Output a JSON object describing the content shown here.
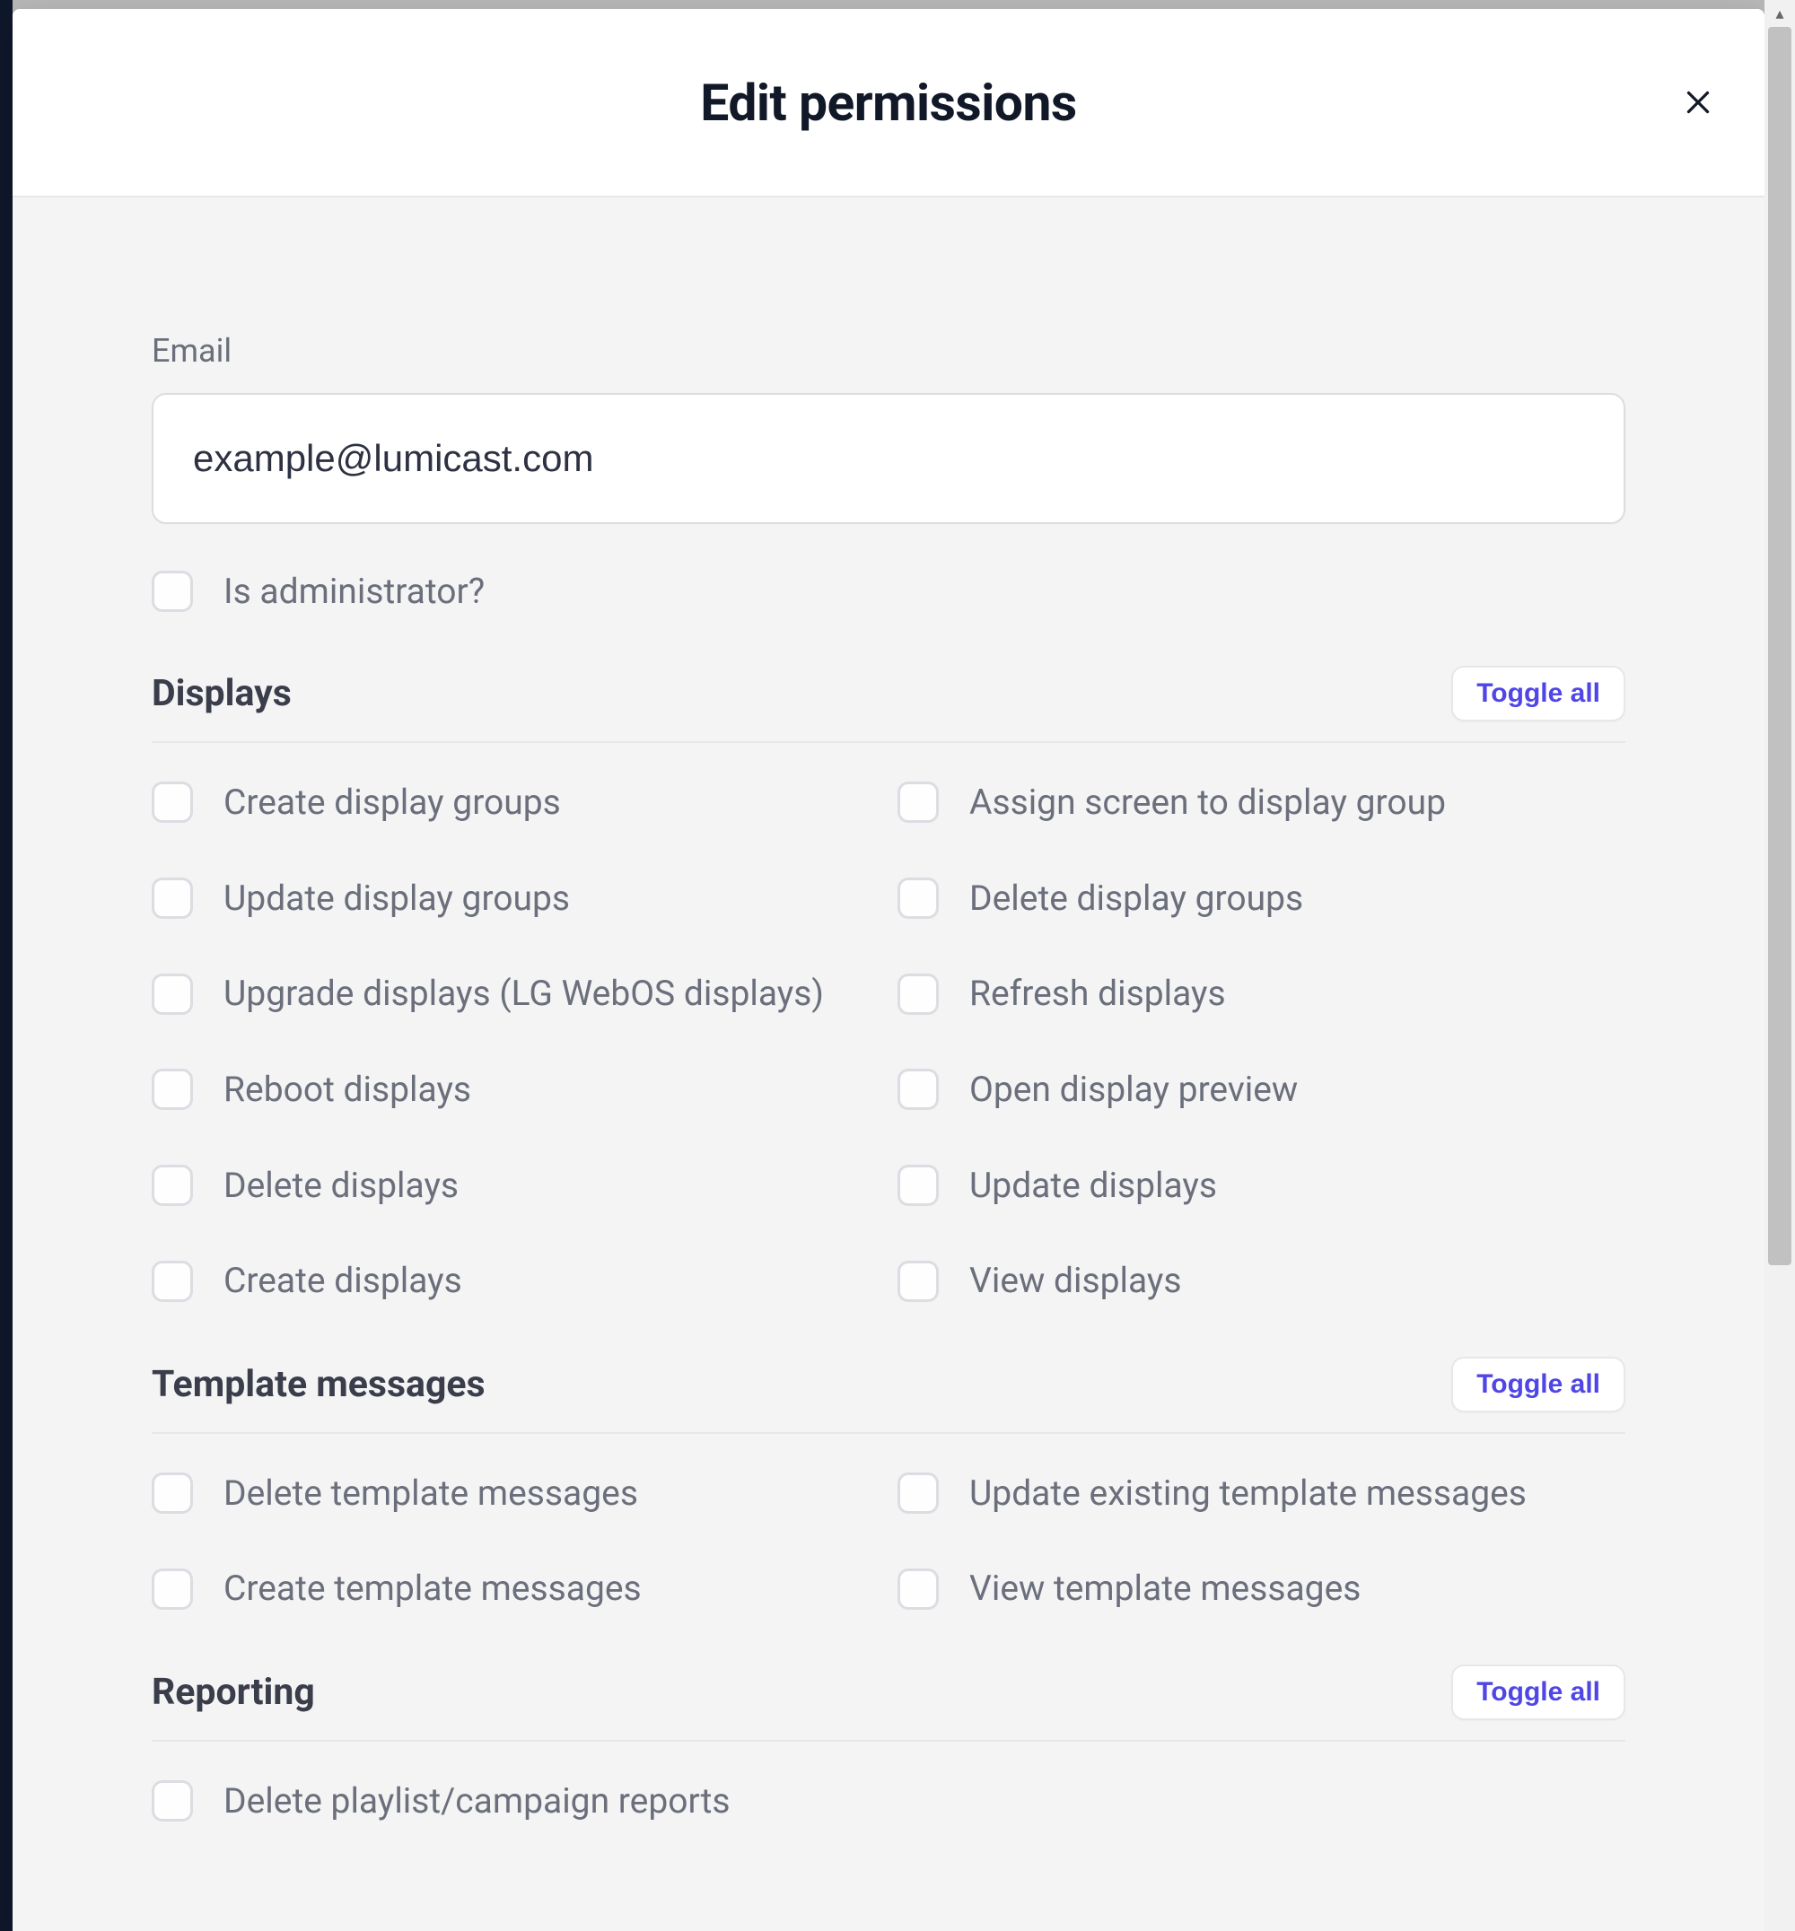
{
  "dialog": {
    "title": "Edit permissions"
  },
  "email": {
    "label": "Email",
    "value": "example@lumicast.com"
  },
  "admin": {
    "label": "Is administrator?"
  },
  "toggle_all_label": "Toggle all",
  "sections": {
    "displays": {
      "title": "Displays",
      "items": [
        "Create display groups",
        "Assign screen to display group",
        "Update display groups",
        "Delete display groups",
        "Upgrade displays (LG WebOS displays)",
        "Refresh displays",
        "Reboot displays",
        "Open display preview",
        "Delete displays",
        "Update displays",
        "Create displays",
        "View displays"
      ]
    },
    "template_messages": {
      "title": "Template messages",
      "items": [
        "Delete template messages",
        "Update existing template messages",
        "Create template messages",
        "View template messages"
      ]
    },
    "reporting": {
      "title": "Reporting",
      "items": [
        "Delete playlist/campaign reports"
      ]
    }
  }
}
